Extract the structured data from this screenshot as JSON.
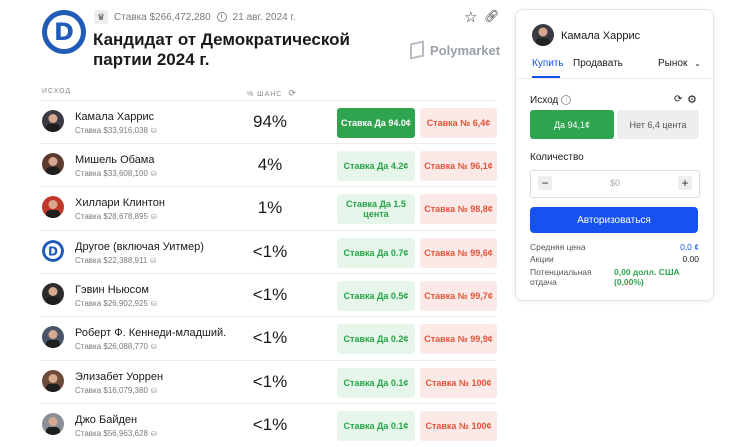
{
  "header": {
    "volume": "Ставка $266,472,280",
    "date": "21 авг. 2024 г.",
    "title": "Кандидат от Демократической партии 2024 г.",
    "brand": "Polymarket",
    "logo_letter": "D"
  },
  "table": {
    "col_outcome": "ИСХОД",
    "col_chance": "% ШАНС",
    "rows": [
      {
        "name": "Камала Харрис",
        "volume": "Ставка $33,916,038",
        "chance": "94%",
        "yes": "Ставка Да 94.0¢",
        "no": "Ставка № 6,4¢",
        "avatar_color": "#3b3a44"
      },
      {
        "name": "Мишель Обама",
        "volume": "Ставка $33,608,100",
        "chance": "4%",
        "yes": "Ставка Да 4.2¢",
        "no": "Ставка № 96,1¢",
        "avatar_color": "#5a3b2e"
      },
      {
        "name": "Хиллари Клинтон",
        "volume": "Ставка $28,678,895",
        "chance": "1%",
        "yes": "Ставка Да 1.5 цента",
        "no": "Ставка № 98,8¢",
        "avatar_color": "#c0392b"
      },
      {
        "name": "Другое (включая Уитмер)",
        "volume": "Ставка $22,388,911",
        "chance": "<1%",
        "yes": "Ставка Да 0.7¢",
        "no": "Ставка № 99,6¢",
        "avatar_color": "#1f5bb8"
      },
      {
        "name": "Гэвин Ньюсом",
        "volume": "Ставка $26,902,925",
        "chance": "<1%",
        "yes": "Ставка Да 0.5¢",
        "no": "Ставка № 99,7¢",
        "avatar_color": "#2c2c2c"
      },
      {
        "name": "Роберт Ф. Кеннеди-младший.",
        "volume": "Ставка $26,088,770",
        "chance": "<1%",
        "yes": "Ставка Да 0.2¢",
        "no": "Ставка № 99,9¢",
        "avatar_color": "#4a5568"
      },
      {
        "name": "Элизабет Уоррен",
        "volume": "Ставка $16,079,380",
        "chance": "<1%",
        "yes": "Ставка Да 0.1¢",
        "no": "Ставка № 100¢",
        "avatar_color": "#6b4a3a"
      },
      {
        "name": "Джо Байден",
        "volume": "Ставка $56,963,628",
        "chance": "<1%",
        "yes": "Ставка Да 0.1¢",
        "no": "Ставка № 100¢",
        "avatar_color": "#8a8f99"
      }
    ]
  },
  "panel": {
    "name": "Камала Харрис",
    "tab_buy": "Купить",
    "tab_sell": "Продавать",
    "market": "Рынок",
    "outcome_label": "Исход",
    "yes_btn": "Да 94,1¢",
    "no_btn": "Нет 6,4 цента",
    "quantity_label": "Количество",
    "quantity_value": "$0",
    "auth_btn": "Авторизоваться",
    "avg_price_label": "Средняя цена",
    "avg_price_value": "0,0 ¢",
    "shares_label": "Акции",
    "shares_value": "0.00",
    "payout_label_1": "Потенциальная",
    "payout_label_2": "отдача",
    "payout_value_1": "0,00 долл. США",
    "payout_value_2": "(0,00%)"
  },
  "colors": {
    "accent": "#1652f0",
    "yes_green": "#2ea44f",
    "no_red": "#e0553a",
    "democrat_blue": "#1f5bb8"
  }
}
